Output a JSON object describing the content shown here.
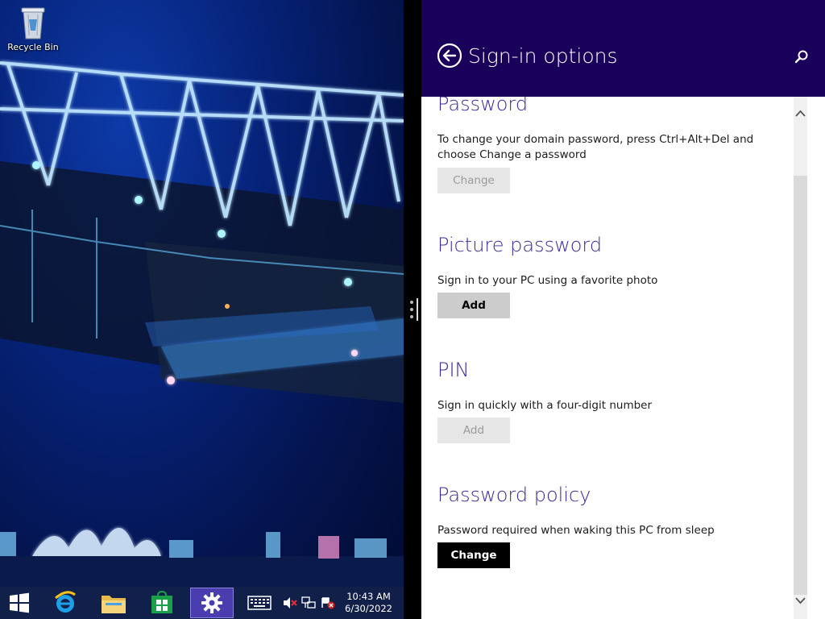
{
  "desktop": {
    "recycle_bin_label": "Recycle Bin",
    "icons": {
      "recycle_bin": "recycle-bin-icon"
    }
  },
  "taskbar": {
    "items": [
      {
        "name": "start-button",
        "icon": "windows-logo-icon"
      },
      {
        "name": "internet-explorer",
        "icon": "ie-icon"
      },
      {
        "name": "file-explorer",
        "icon": "folder-icon"
      },
      {
        "name": "store",
        "icon": "store-icon"
      },
      {
        "name": "pc-settings",
        "icon": "gear-icon",
        "active": true
      },
      {
        "name": "touch-keyboard",
        "icon": "keyboard-icon"
      }
    ],
    "tray": [
      "volume-muted-icon",
      "network-icon",
      "action-center-icon"
    ],
    "clock": {
      "time": "10:43 AM",
      "date": "6/30/2022"
    }
  },
  "pane": {
    "title": "Sign-in options",
    "sections": {
      "password": {
        "title": "Password",
        "description": "To change your domain password, press Ctrl+Alt+Del and choose Change a password",
        "button": "Change",
        "button_state": "disabled"
      },
      "picture_password": {
        "title": "Picture password",
        "description": "Sign in to your PC using a favorite photo",
        "button": "Add",
        "button_state": "enabled"
      },
      "pin": {
        "title": "PIN",
        "description": "Sign in quickly with a four-digit number",
        "button": "Add",
        "button_state": "disabled"
      },
      "password_policy": {
        "title": "Password policy",
        "description": "Password required when waking this PC from sleep",
        "button": "Change",
        "button_state": "focused"
      }
    }
  },
  "colors": {
    "header_bg": "#19005a",
    "title_accent": "#3b2a99",
    "taskbar_bg": "#12224a",
    "active_taskbar_item": "#4a3db0"
  }
}
